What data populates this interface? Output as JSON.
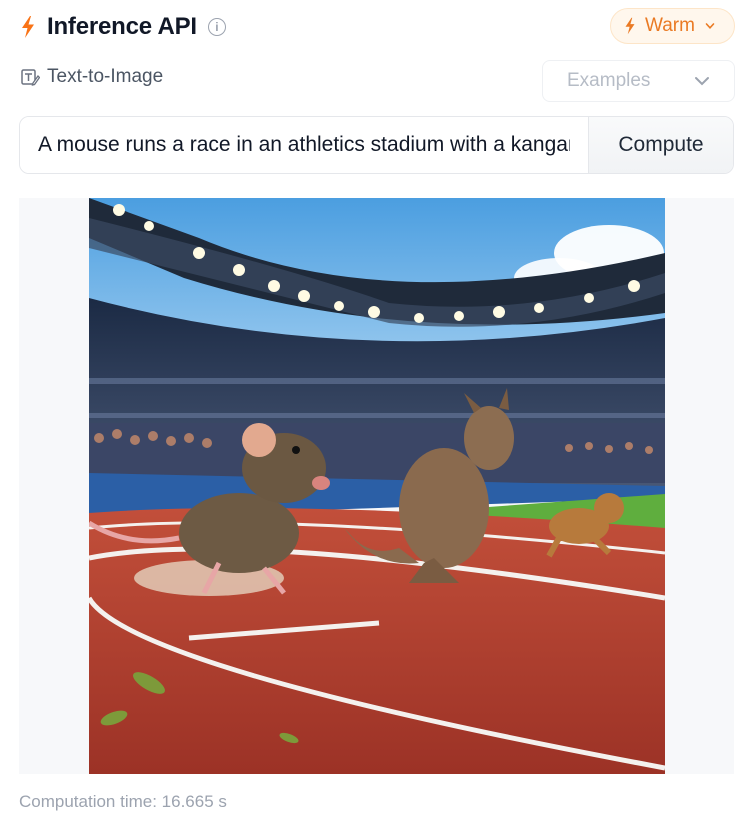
{
  "header": {
    "title": "Inference API",
    "status_label": "Warm",
    "accent_color": "#f97316",
    "icons": [
      "lightning-icon",
      "info-icon",
      "chevron-down-icon"
    ]
  },
  "task": {
    "label": "Text-to-Image",
    "icon": "text-to-image-icon"
  },
  "examples": {
    "placeholder": "Examples"
  },
  "prompt": {
    "value": "A mouse runs a race in an athletics stadium with a kangaroo and a dog"
  },
  "compute_label": "Compute",
  "footer": {
    "computation_time": "Computation time: 16.665 s"
  }
}
